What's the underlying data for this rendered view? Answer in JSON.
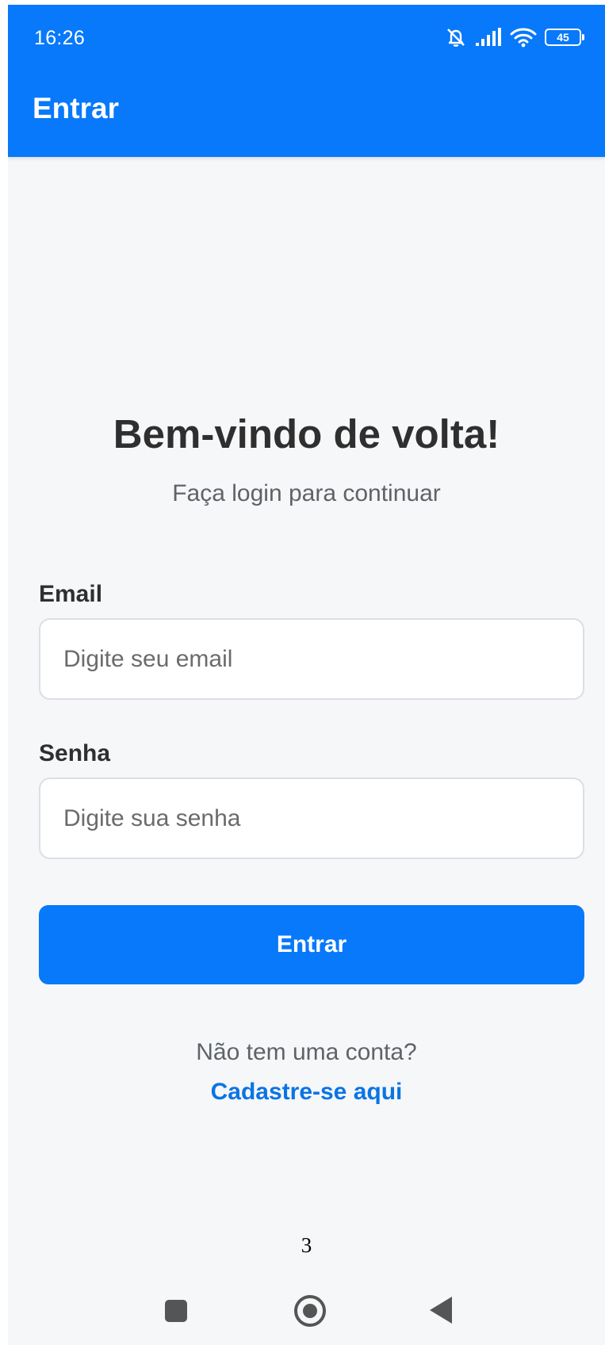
{
  "status_bar": {
    "time": "16:26",
    "battery": "45",
    "icons": [
      "bell-off-icon",
      "signal-icon",
      "wifi-icon",
      "battery-icon"
    ]
  },
  "header": {
    "title": "Entrar"
  },
  "welcome": {
    "title": "Bem-vindo de volta!",
    "subtitle": "Faça login para continuar"
  },
  "form": {
    "email_label": "Email",
    "email_value": "",
    "email_placeholder": "Digite seu email",
    "password_label": "Senha",
    "password_value": "",
    "password_placeholder": "Digite sua senha",
    "submit_label": "Entrar"
  },
  "signup": {
    "prompt": "Não tem uma conta?",
    "link": "Cadastre-se aqui"
  },
  "page_number": "3",
  "nav_bar": {
    "buttons": [
      "recent-apps-icon",
      "home-icon",
      "back-icon"
    ]
  },
  "colors": {
    "primary": "#0779fa",
    "background": "#f6f7f9",
    "link": "#0b74e5",
    "text_dark": "#2f2f2f",
    "text_muted": "#5f6368"
  }
}
